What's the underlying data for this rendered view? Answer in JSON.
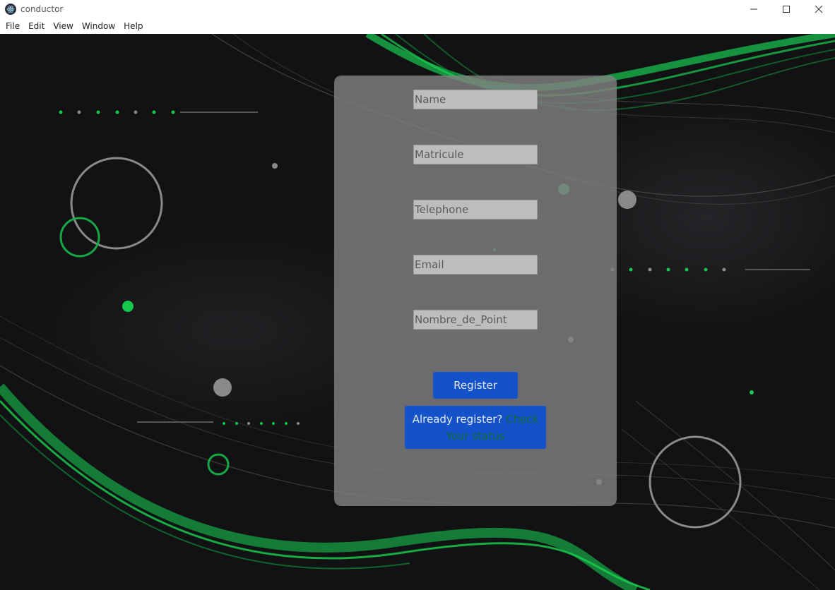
{
  "window": {
    "title": "conductor",
    "icon": "electron-atom-icon"
  },
  "menu": {
    "items": [
      "File",
      "Edit",
      "View",
      "Window",
      "Help"
    ]
  },
  "form": {
    "fields": [
      {
        "placeholder": "Name",
        "value": ""
      },
      {
        "placeholder": "Matricule",
        "value": ""
      },
      {
        "placeholder": "Telephone",
        "value": ""
      },
      {
        "placeholder": "Email",
        "value": ""
      },
      {
        "placeholder": "Nombre_de_Point",
        "value": ""
      }
    ],
    "register_label": "Register",
    "already_text": "Already register? ",
    "check_link": "Check Your status"
  },
  "colors": {
    "accent_blue": "#1352c9",
    "green": "#13c84a",
    "link_green": "#0f6b2f"
  }
}
